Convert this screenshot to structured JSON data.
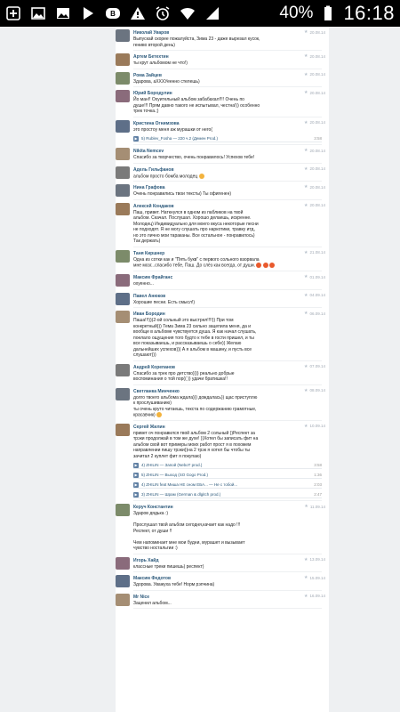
{
  "status": {
    "battery": "40%",
    "time": "16:18"
  },
  "colors": {
    "name_link": "#2b587a",
    "page_bg": "#eef0f2",
    "status_bar": "#000000"
  },
  "comments": [
    {
      "name": "Николай Уваров",
      "date": "20.08.14",
      "text": "Выпускай скорее пожалуйста, Зима 23 - даже вырезал кусок,\nгениво второй день)"
    },
    {
      "name": "Артем Бетехтин",
      "date": "20.08.14",
      "text": "ты крут альбомом не что!)"
    },
    {
      "name": "Рома Зайцев",
      "date": "20.08.14",
      "text": "Здарова, аХХХУеенно стелешь)"
    },
    {
      "name": "Юрий Бородулин",
      "date": "20.08.14",
      "text": "Йо ман!! Охуительный альбом забабахал!!!! Очень по\nдуше!!! Прям давно такого не испытывал, честна!)) особенно\nтрек точка.;)"
    },
    {
      "name": "Кристина Огнимзова",
      "date": "20.08.14",
      "text": "это простоу меня аж мурашки от него(",
      "tracks": [
        {
          "title": "5) Rublev_Fosha — 220 ч.2 (Демен Prod.)",
          "dur": "3:58"
        }
      ]
    },
    {
      "name": "Nikita Nemcev",
      "date": "20.08.14",
      "text": "Спасибо за творчество, очень понравилось! Успехов тебе!"
    },
    {
      "name": "Адель Гильфанов",
      "date": "20.08.14",
      "text": "альбом просто бомба молодец",
      "emoji": [
        "smile"
      ]
    },
    {
      "name": "Нина Графова",
      "date": "20.08.14",
      "text": "Очень понравились твои тексты) Ты офигенен)"
    },
    {
      "name": "Алексей Кондаков",
      "date": "20.08.14",
      "text": "Паш, привет. Наткнулся в одном из пабликов на твой\nальбом. Скачал. Послушал. Хорошо делаешь, искренне.\nМолодец) Индивидуально для моего вкуса некоторые песни\nне подходят. Я не могу слушать про наркотики, травку итд,\nно это лично мои тараканы. Все остальное - понравилось)\nТак держать)"
    },
    {
      "name": "Таня Киршнер",
      "date": "21.08.14",
      "text": "Одна из сотки как и \"Пять букв\" с первого сольного взорвала\nмне мозг...спасибо тебе, Паш. До слёз как всегда, от души.",
      "emoji": [
        "red",
        "red",
        "red"
      ]
    },
    {
      "name": "Максим Фрайганс",
      "date": "01.09.14",
      "text": "охуенно..."
    },
    {
      "name": "Павел Анюков",
      "date": "04.09.14",
      "text": "Хорошие песни. Есть смысл!)"
    },
    {
      "name": "Иван Бородин",
      "date": "06.09.14",
      "text": "Паша!!!)))2-ой сольный это выстрел!!!!)) При том\nконкретный))) Тема Зима 23 сильно зацепила меня, да и\nвообще в альбоме чувствуется душа. Я как начал слушать,\nпоелало ощущения того будто к тебе в гости пришел, и ты\nвсе показываешь, и рассказываешь о себе)) Желаю\nдальнейших успехов))) А я альбом в машину, и пусть все\nслушают)))"
    },
    {
      "name": "Андрей Корепанов",
      "date": "07.09.14",
      "text": "Спасибо за трек про детство)))) реально добрые\nвоспоминания о той пор(( )) удачи братишка!!"
    },
    {
      "name": "Светланка Минченко",
      "date": "08.09.14",
      "text": "долго твоего альбома ждала))) дождалась)) щас приступлю\nк прослушиванию)\nты очень круто читаешь, текста по содержанию грамотные,\nкрасавчик)",
      "emoji": [
        "smile"
      ]
    },
    {
      "name": "Сергей Жилин",
      "date": "10.09.14",
      "text": "привет оч понравился твой альбом 2 сольный ))Респект за\nтрэки продолжай в том же духе! ))Хотел бы записать фит на\nальбом свой вот примеры моих работ прост я в похожем\nнаправлении пишу трэки))на 2 трэк я хотел бы чтобы ты\nзачитал 2 куплет фит я покупаю)",
      "tracks": [
        {
          "title": "4) ZHILIN — Запой (NeboT prod.)",
          "dur": "3:58"
        },
        {
          "title": "5) ZHILIN — Выход (SO Gogo Prod.)",
          "dur": "1:36"
        },
        {
          "title": "4) ZHILIN feat Миша НЕ сном ЕБА... — Не с тобой...",
          "dur": "2:03"
        },
        {
          "title": "3) ZHILIN — Шрам (German & dlgitch prod.)",
          "dur": "2:47"
        }
      ]
    },
    {
      "name": "Керуч Константин",
      "date": "11.09.14",
      "text": "Здаров дядька :)\n\nПрослушал твой альбом сегодня,качает как надо !!!\nРеспект, от души !!\n\nЧем напоминает мне мои будни, мурашет и вызывает\nчувство ностальгии :)"
    },
    {
      "name": "Игорь Хайд",
      "date": "13.09.14",
      "text": "классные треки пишешь) респект)"
    },
    {
      "name": "Максим Федотов",
      "date": "15.09.14",
      "text": "Здорова. Уважуха тебе! Норм рэпчина)"
    },
    {
      "name": "Mr Nice",
      "date": "16.09.14",
      "text": "Заценил альбом..."
    }
  ]
}
